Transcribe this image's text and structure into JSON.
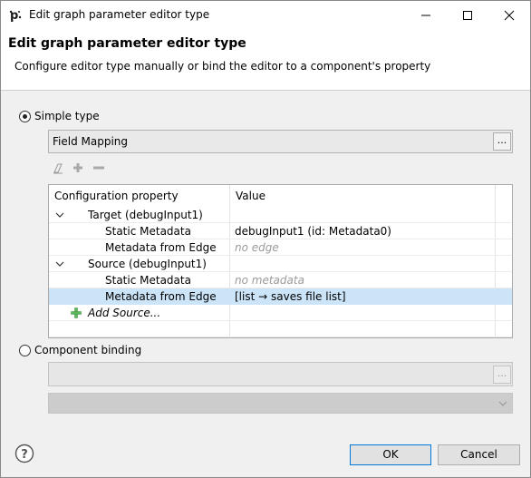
{
  "window": {
    "title": "Edit graph parameter editor type"
  },
  "header": {
    "title": "Edit graph parameter editor type",
    "description": "Configure editor type manually or bind the editor to a component's property"
  },
  "simple_type": {
    "label": "Simple type",
    "checked": true,
    "value": "Field Mapping",
    "browse_label": "..."
  },
  "table": {
    "columns": [
      "Configuration property",
      "Value"
    ],
    "rows": [
      {
        "type": "group",
        "label": "Target (debugInput1)",
        "value": ""
      },
      {
        "type": "item",
        "label": "Static Metadata",
        "value": "debugInput1 (id: Metadata0)",
        "muted": false
      },
      {
        "type": "item",
        "label": "Metadata from Edge",
        "value": "no edge",
        "muted": true
      },
      {
        "type": "group",
        "label": "Source (debugInput1)",
        "value": ""
      },
      {
        "type": "item",
        "label": "Static Metadata",
        "value": "no metadata",
        "muted": true
      },
      {
        "type": "item",
        "label": "Metadata from Edge",
        "value": "[list → saves file list]",
        "muted": false,
        "selected": true
      }
    ],
    "add_source_label": "Add Source..."
  },
  "component_binding": {
    "label": "Component binding",
    "checked": false,
    "browse_label": "..."
  },
  "buttons": {
    "ok": "OK",
    "cancel": "Cancel"
  },
  "colors": {
    "selection": "#cce4f7",
    "accent": "#0078d7",
    "add_icon": "#4caf50"
  }
}
